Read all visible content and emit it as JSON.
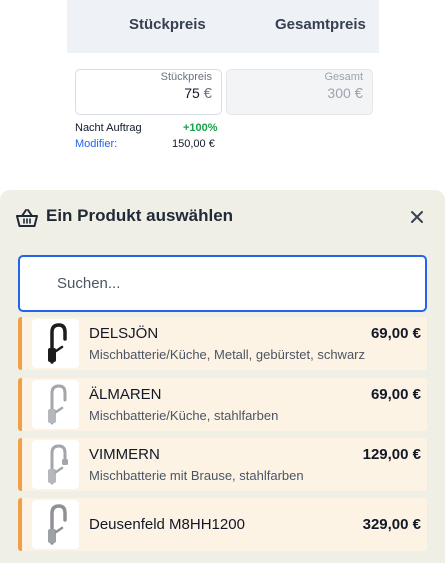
{
  "pricing": {
    "header_unit_price": "Stückpreis",
    "header_total_price": "Gesamtpreis",
    "unit_field_label": "Stückpreis",
    "unit_field_value": "75",
    "total_field_label": "Gesamt",
    "total_field_value": "300",
    "currency": "€",
    "night_label": "Nacht Auftrag",
    "night_value": "+100%",
    "modifier_label": "Modifier:",
    "modifier_value": "150,00 €"
  },
  "picker": {
    "title": "Ein Produkt auswählen",
    "search_placeholder": "Suchen...",
    "products": [
      {
        "name": "DELSJÖN",
        "description": "Mischbatterie/Küche, Metall, gebürstet, schwarz",
        "price": "69,00 €",
        "finish": "black"
      },
      {
        "name": "ÄLMAREN",
        "description": "Mischbatterie/Küche, stahlfarben",
        "price": "69,00 €",
        "finish": "steel"
      },
      {
        "name": "VIMMERN",
        "description": "Mischbatterie mit Brause, stahlfarben",
        "price": "129,00 €",
        "finish": "steel"
      },
      {
        "name": "Deusenfeld M8HH1200",
        "description": "",
        "price": "329,00 €",
        "finish": "steel"
      }
    ]
  },
  "colors": {
    "accent_blue": "#2563eb",
    "item_border_orange": "#f1a04a",
    "item_background": "#fdf3e4",
    "positive_green": "#16a34a",
    "panel_background": "#f0efe6"
  }
}
